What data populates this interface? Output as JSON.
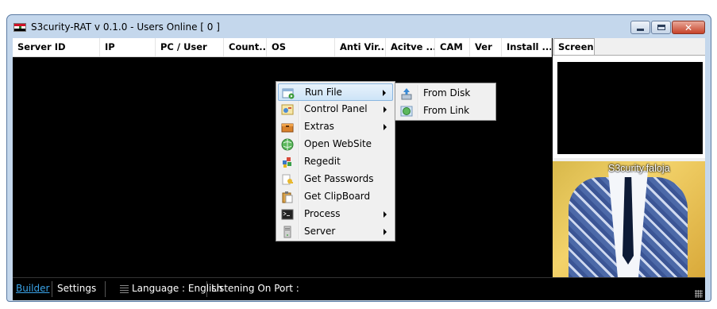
{
  "window": {
    "title": "S3curity-RAT v 0.1.0 - Users Online [ 0 ]",
    "icon": "iraq-flag-icon",
    "controls": [
      "minimize-icon",
      "maximize-icon",
      "close-icon"
    ]
  },
  "listview": {
    "columns": [
      "Server ID",
      "IP",
      "PC / User",
      "Count...",
      "OS",
      "Anti Vir...",
      "Acitve ...",
      "CAM",
      "Ver",
      "Install ..."
    ],
    "rows": []
  },
  "right_panel": {
    "tabs": [
      "Screen"
    ],
    "photo_caption": "S3curity.faloja"
  },
  "context_menu": {
    "items": [
      {
        "label": "Run File",
        "icon": "run-file-icon",
        "submenu": true,
        "highlighted": true
      },
      {
        "label": "Control Panel",
        "icon": "control-panel-icon",
        "submenu": true
      },
      {
        "label": "Extras",
        "icon": "extras-icon",
        "submenu": true
      },
      {
        "label": "Open WebSite",
        "icon": "globe-icon",
        "submenu": false
      },
      {
        "label": "Regedit",
        "icon": "regedit-icon",
        "submenu": false
      },
      {
        "label": "Get Passwords",
        "icon": "key-icon",
        "submenu": false
      },
      {
        "label": "Get ClipBoard",
        "icon": "clipboard-icon",
        "submenu": false
      },
      {
        "label": "Process",
        "icon": "terminal-icon",
        "submenu": true
      },
      {
        "label": "Server",
        "icon": "server-icon",
        "submenu": true
      }
    ],
    "submenu": {
      "items": [
        {
          "label": "From Disk",
          "icon": "disk-upload-icon"
        },
        {
          "label": "From Link",
          "icon": "link-globe-icon"
        }
      ]
    }
  },
  "statusbar": {
    "builder": "Builder",
    "settings": "Settings",
    "language": "Language : English",
    "listening": "Listening On Port :"
  },
  "colors": {
    "accent_link": "#3aa3e8",
    "menu_highlight": "#cde4f7",
    "list_background": "#000000"
  }
}
